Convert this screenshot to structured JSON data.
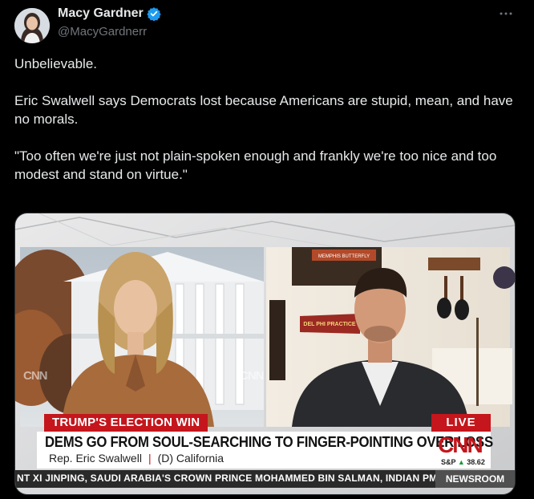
{
  "author": {
    "display_name": "Macy Gardner",
    "handle": "@MacyGardnerr",
    "verified": true
  },
  "menu_icon": "more-horizontal-icon",
  "tweet": {
    "paragraphs": [
      "Unbelievable.",
      "Eric Swalwell says Democrats lost because Americans are stupid, mean, and have no morals.",
      "\"Too often we're just not plain-spoken enough and frankly we're too nice and too modest and stand on virtue.\""
    ]
  },
  "video": {
    "chyron_topic": "TRUMP'S ELECTION WIN",
    "live_label": "LIVE",
    "headline": "DEMS GO FROM SOUL-SEARCHING TO FINGER-POINTING OVER LOSS",
    "guest_name": "Rep. Eric Swalwell",
    "guest_affiliation": "(D) California",
    "network_logo": "CNN",
    "watermark_left": "CNN",
    "watermark_center": "CNN",
    "stock_label": "S&P",
    "stock_value": "38.62",
    "ticker": "NT XI JINPING, SAUDI ARABIA'S CROWN PRINCE MOHAMMED BIN SALMAN, INDIAN PM",
    "ticker_section": "NEWSROOM",
    "sign_text": "MEMPHIS BUTTERFLY",
    "pennant_text": "DEL PHI PRACTICE"
  },
  "colors": {
    "background": "#000000",
    "text": "#e7e9ea",
    "muted": "#71767b",
    "verified": "#1d9bf0",
    "cnn_red": "#c4161c"
  }
}
